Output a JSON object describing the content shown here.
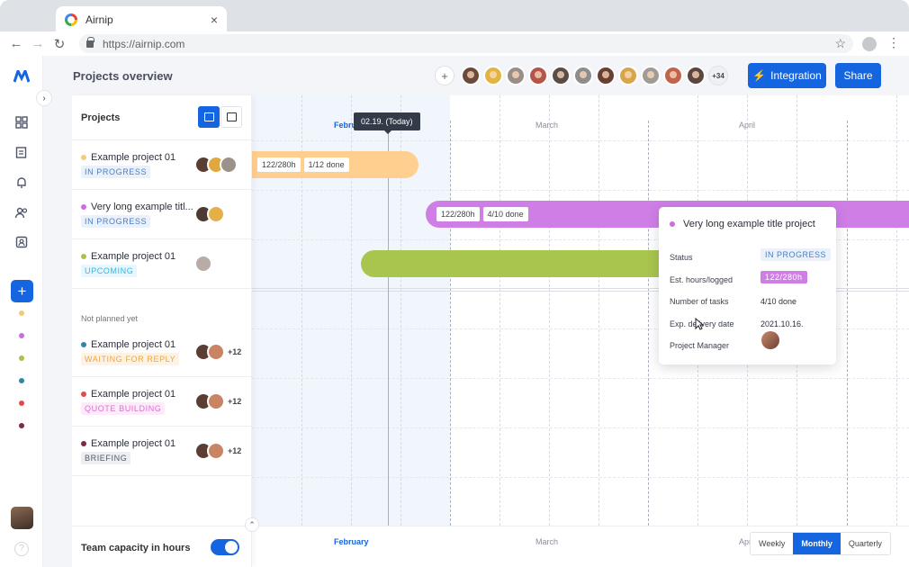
{
  "browser": {
    "tab_title": "Airnip",
    "url": "https://airnip.com"
  },
  "header": {
    "title": "Projects overview",
    "avatars_extra": "+34",
    "integration_label": "Integration",
    "share_label": "Share"
  },
  "colors": {
    "accent": "#1565e0",
    "orange_bar": "#ffcf8f",
    "purple_bar": "#cf7ee6",
    "green_bar": "#a8c64e"
  },
  "sidebar_dots": [
    "#f7c97a",
    "#c96ee0",
    "#a9c24a",
    "#2f86a5",
    "#e14b4b",
    "#7a2a4b"
  ],
  "projects_panel": {
    "title": "Projects",
    "not_planned_label": "Not planned yet",
    "planned": [
      {
        "name": "Example project 01",
        "status": "IN PROGRESS",
        "dot": "#f7c97a",
        "status_fg": "#4a7fbf",
        "status_bg": "#eaf1fb",
        "extra": ""
      },
      {
        "name": "Very long example titl...",
        "status": "IN PROGRESS",
        "dot": "#c96ee0",
        "status_fg": "#4a7fbf",
        "status_bg": "#eaf1fb",
        "extra": ""
      },
      {
        "name": "Example project 01",
        "status": "UPCOMING",
        "dot": "#a9c24a",
        "status_fg": "#2fb7e8",
        "status_bg": "#e7f7fd",
        "extra": ""
      }
    ],
    "unplanned": [
      {
        "name": "Example project 01",
        "status": "WAITING FOR REPLY",
        "dot": "#2f86a5",
        "status_fg": "#f2a33a",
        "status_bg": "#fdf3e4",
        "extra": "+12"
      },
      {
        "name": "Example project 01",
        "status": "QUOTE BUILDING",
        "dot": "#e14b4b",
        "status_fg": "#e36bd5",
        "status_bg": "#fcebf9",
        "extra": "+12"
      },
      {
        "name": "Example project 01",
        "status": "BRIEFING",
        "dot": "#7a2a4b",
        "status_fg": "#555b66",
        "status_bg": "#eceef1",
        "extra": "+12"
      }
    ],
    "capacity_label": "Team capacity in hours",
    "capacity_on": true
  },
  "timeline": {
    "months": [
      "February",
      "March",
      "April"
    ],
    "today_label": "02.19. (Today)",
    "bars": [
      {
        "hours": "122/280h",
        "tasks": "1/12 done"
      },
      {
        "hours": "122/280h",
        "tasks": "4/10 done"
      },
      {
        "hours": "",
        "tasks": ""
      }
    ],
    "views": [
      "Weekly",
      "Monthly",
      "Quarterly"
    ],
    "active_view": "Monthly"
  },
  "tooltip": {
    "title": "Very long example title project",
    "status_label": "Status",
    "status_value": "IN PROGRESS",
    "hours_label": "Est. hours/logged",
    "hours_value": "122/280h",
    "tasks_label": "Number of tasks",
    "tasks_value": "4/10 done",
    "delivery_label": "Exp. delivery date",
    "delivery_value": "2021.10.16.",
    "pm_label": "Project Manager"
  }
}
